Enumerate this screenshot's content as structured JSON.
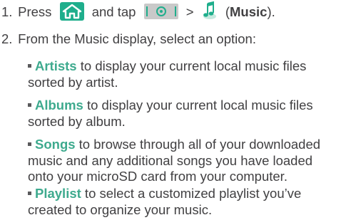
{
  "steps": [
    {
      "number": "1.",
      "text_press": "Press",
      "text_and_tap": "and tap",
      "text_gt": ">",
      "text_music_open": "(",
      "text_music": "Music",
      "text_music_close": ")."
    },
    {
      "number": "2.",
      "text": "From the Music display, select an option:"
    }
  ],
  "options": [
    {
      "term": "Artists",
      "description": " to display your current local music files sorted by artist."
    },
    {
      "term": "Albums",
      "description": " to display your current local music files sorted by album."
    },
    {
      "term": "Songs",
      "description": " to browse through all of your downloaded music and any additional songs you have loaded onto your microSD card from your computer."
    },
    {
      "term": "Playlist",
      "description": " to select a customized playlist you’ve created to organize your music."
    }
  ],
  "icons": {
    "home": "home-key-icon",
    "launcher": "launcher-key-icon",
    "music": "music-app-icon"
  },
  "colors": {
    "text": "#414042",
    "term": "#3eaa8e",
    "icon_green": "#1fae8c"
  }
}
